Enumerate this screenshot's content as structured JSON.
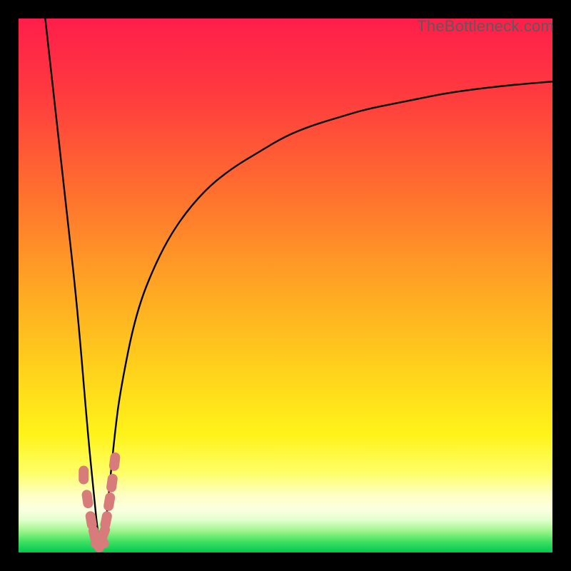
{
  "watermark": "TheBottleneck.com",
  "chart_data": {
    "type": "line",
    "title": "",
    "xlabel": "",
    "ylabel": "",
    "xlim": [
      0,
      100
    ],
    "ylim": [
      0,
      100
    ],
    "grid": false,
    "legend": false,
    "notes": "V-shaped bottleneck curve over a vertical red→orange→yellow→green gradient; minimum around x≈15; right branch plateaus near y≈88; small salmon bead markers near the trough.",
    "series": [
      {
        "name": "bottleneck-curve",
        "x": [
          5,
          7,
          9,
          11,
          13,
          14,
          15,
          16,
          17,
          18,
          19,
          22,
          26,
          30,
          35,
          40,
          45,
          50,
          55,
          60,
          65,
          70,
          75,
          80,
          85,
          90,
          95,
          100
        ],
        "y": [
          100,
          82,
          64,
          46,
          22,
          12,
          2,
          2,
          12,
          22,
          30,
          45,
          55,
          62,
          68,
          72,
          75,
          78,
          80,
          81.5,
          83,
          84,
          85,
          86,
          86.7,
          87.3,
          87.8,
          88.2
        ]
      }
    ],
    "markers": {
      "name": "trough-beads",
      "x": [
        12.2,
        12.9,
        13.6,
        14.2,
        14.8,
        15.2,
        15.9,
        16.4,
        17.0,
        17.5,
        18.0
      ],
      "y": [
        14.5,
        10.0,
        6.0,
        3.3,
        1.7,
        1.7,
        3.5,
        6.0,
        9.5,
        13.0,
        17.0
      ]
    },
    "gradient_stops": [
      {
        "pct": 0,
        "color": "#ff1e4b"
      },
      {
        "pct": 14,
        "color": "#ff3a3f"
      },
      {
        "pct": 32,
        "color": "#ff6e2f"
      },
      {
        "pct": 50,
        "color": "#ffa524"
      },
      {
        "pct": 66,
        "color": "#ffd21c"
      },
      {
        "pct": 78,
        "color": "#fff31a"
      },
      {
        "pct": 85,
        "color": "#ffff66"
      },
      {
        "pct": 89,
        "color": "#ffffc0"
      },
      {
        "pct": 92,
        "color": "#fcffe0"
      },
      {
        "pct": 94,
        "color": "#e0ffca"
      },
      {
        "pct": 96,
        "color": "#9cf58a"
      },
      {
        "pct": 98,
        "color": "#3fe060"
      },
      {
        "pct": 100,
        "color": "#00c94f"
      }
    ]
  }
}
